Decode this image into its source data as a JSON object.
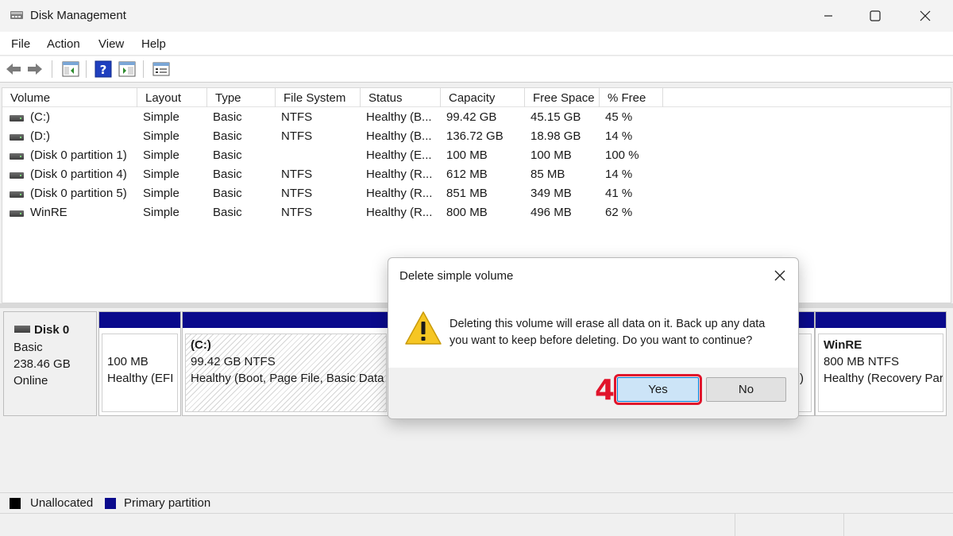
{
  "window": {
    "title": "Disk Management",
    "icon": "disk-management-icon",
    "controls": [
      "minimize-icon",
      "maximize-icon",
      "close-icon"
    ]
  },
  "menu": {
    "file": "File",
    "action": "Action",
    "view": "View",
    "help": "Help"
  },
  "toolbar": {
    "icons": [
      "back-arrow-icon",
      "forward-arrow-icon",
      "console-tree-icon",
      "help-icon",
      "properties-icon",
      "disk-list-icon"
    ]
  },
  "table": {
    "columns": [
      "Volume",
      "Layout",
      "Type",
      "File System",
      "Status",
      "Capacity",
      "Free Space",
      "% Free"
    ],
    "rows": [
      [
        "(C:)",
        "Simple",
        "Basic",
        "NTFS",
        "Healthy (B...",
        "99.42 GB",
        "45.15 GB",
        "45 %"
      ],
      [
        "(D:)",
        "Simple",
        "Basic",
        "NTFS",
        "Healthy (B...",
        "136.72 GB",
        "18.98 GB",
        "14 %"
      ],
      [
        "(Disk 0 partition 1)",
        "Simple",
        "Basic",
        "",
        "Healthy (E...",
        "100 MB",
        "100 MB",
        "100 %"
      ],
      [
        "(Disk 0 partition 4)",
        "Simple",
        "Basic",
        "NTFS",
        "Healthy (R...",
        "612 MB",
        "85 MB",
        "14 %"
      ],
      [
        "(Disk 0 partition 5)",
        "Simple",
        "Basic",
        "NTFS",
        "Healthy (R...",
        "851 MB",
        "349 MB",
        "41 %"
      ],
      [
        "WinRE",
        "Simple",
        "Basic",
        "NTFS",
        "Healthy (R...",
        "800 MB",
        "496 MB",
        "62 %"
      ]
    ]
  },
  "disk": {
    "name": "Disk 0",
    "type": "Basic",
    "size": "238.46 GB",
    "state": "Online",
    "partitions": [
      {
        "name": "",
        "size": "100 MB",
        "status": "Healthy (EFI Sy"
      },
      {
        "name": "(C:)",
        "size": "99.42 GB NTFS",
        "status": "Healthy (Boot, Page File, Basic Data Par"
      },
      {
        "name": "",
        "size": "",
        "status": ")"
      },
      {
        "name": "WinRE",
        "size": "800 MB NTFS",
        "status": "Healthy (Recovery Partit"
      }
    ]
  },
  "legend": {
    "unallocated": "Unallocated",
    "primary": "Primary partition",
    "unallocated_color": "#000000",
    "primary_color": "#0a0a8c"
  },
  "dialog": {
    "title": "Delete simple volume",
    "message": "Deleting this volume will erase all data on it. Back up any data you want to keep before deleting. Do you want to continue?",
    "icon": "warning-icon",
    "yes": "Yes",
    "no": "No",
    "step": "4",
    "highlight_color": "#e1142b"
  }
}
